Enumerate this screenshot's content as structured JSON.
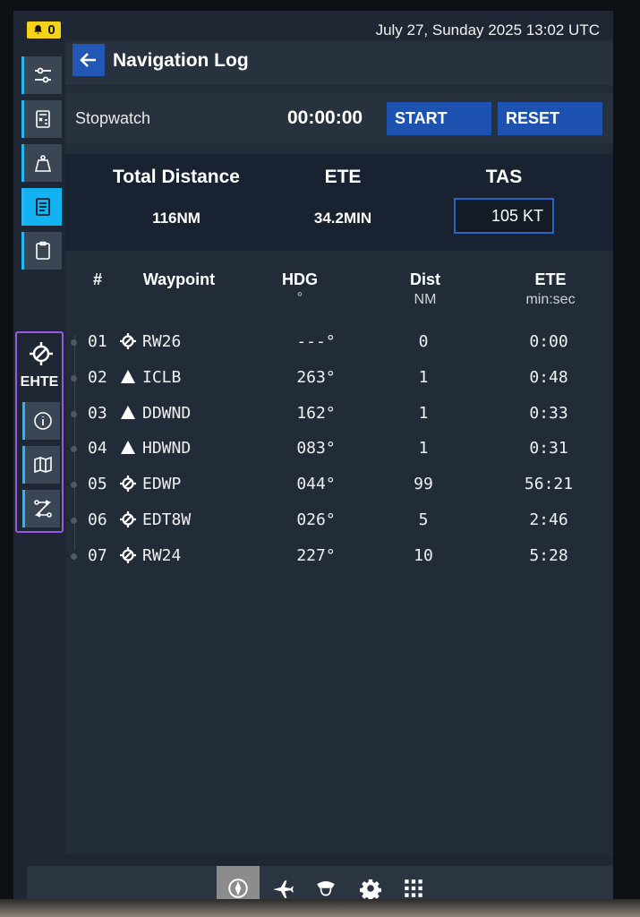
{
  "status": {
    "alert_count": "0",
    "datetime": "July 27, Sunday 2025 13:02 UTC"
  },
  "sidebar": {
    "items": [
      {
        "icon": "sliders-icon"
      },
      {
        "icon": "calculator-icon"
      },
      {
        "icon": "weight-icon"
      },
      {
        "icon": "nav-log-icon",
        "active": true
      },
      {
        "icon": "clipboard-icon"
      }
    ],
    "ehte": {
      "label": "EHTE",
      "icon": "airport-target-icon",
      "buttons": [
        {
          "icon": "info-icon"
        },
        {
          "icon": "map-icon"
        },
        {
          "icon": "route-icon"
        }
      ]
    }
  },
  "header": {
    "title": "Navigation Log"
  },
  "stopwatch": {
    "label": "Stopwatch",
    "time": "00:00:00",
    "start_label": "START",
    "reset_label": "RESET"
  },
  "summary": {
    "total_distance_label": "Total Distance",
    "total_distance_value": "116NM",
    "ete_label": "ETE",
    "ete_value": "34.2MIN",
    "tas_label": "TAS",
    "tas_value": "105 KT"
  },
  "table": {
    "headers": {
      "num": "#",
      "waypoint": "Waypoint",
      "hdg": "HDG",
      "hdg_unit": "°",
      "dist": "Dist",
      "dist_unit": "NM",
      "ete": "ETE",
      "ete_unit": "min:sec"
    },
    "rows": [
      {
        "num": "01",
        "type": "airport",
        "name": "RW26",
        "hdg": "---°",
        "dist": "0",
        "ete": "0:00"
      },
      {
        "num": "02",
        "type": "waypoint",
        "name": "ICLB",
        "hdg": "263°",
        "dist": "1",
        "ete": "0:48"
      },
      {
        "num": "03",
        "type": "waypoint",
        "name": "DDWND",
        "hdg": "162°",
        "dist": "1",
        "ete": "0:33"
      },
      {
        "num": "04",
        "type": "waypoint",
        "name": "HDWND",
        "hdg": "083°",
        "dist": "1",
        "ete": "0:31"
      },
      {
        "num": "05",
        "type": "airport",
        "name": "EDWP",
        "hdg": "044°",
        "dist": "99",
        "ete": "56:21"
      },
      {
        "num": "06",
        "type": "airport",
        "name": "EDT8W",
        "hdg": "026°",
        "dist": "5",
        "ete": "2:46"
      },
      {
        "num": "07",
        "type": "airport",
        "name": "RW24",
        "hdg": "227°",
        "dist": "10",
        "ete": "5:28"
      }
    ]
  },
  "bottom_nav": {
    "items": [
      {
        "icon": "compass-icon",
        "active": true
      },
      {
        "icon": "airplane-icon"
      },
      {
        "icon": "pilot-icon"
      },
      {
        "icon": "gear-icon"
      },
      {
        "icon": "apps-grid-icon"
      }
    ]
  },
  "colors": {
    "accent_blue": "#1e52b0",
    "sidebar_active": "#12b3f0",
    "alert_yellow": "#f5d31a",
    "ehte_border": "#9a59e0"
  }
}
